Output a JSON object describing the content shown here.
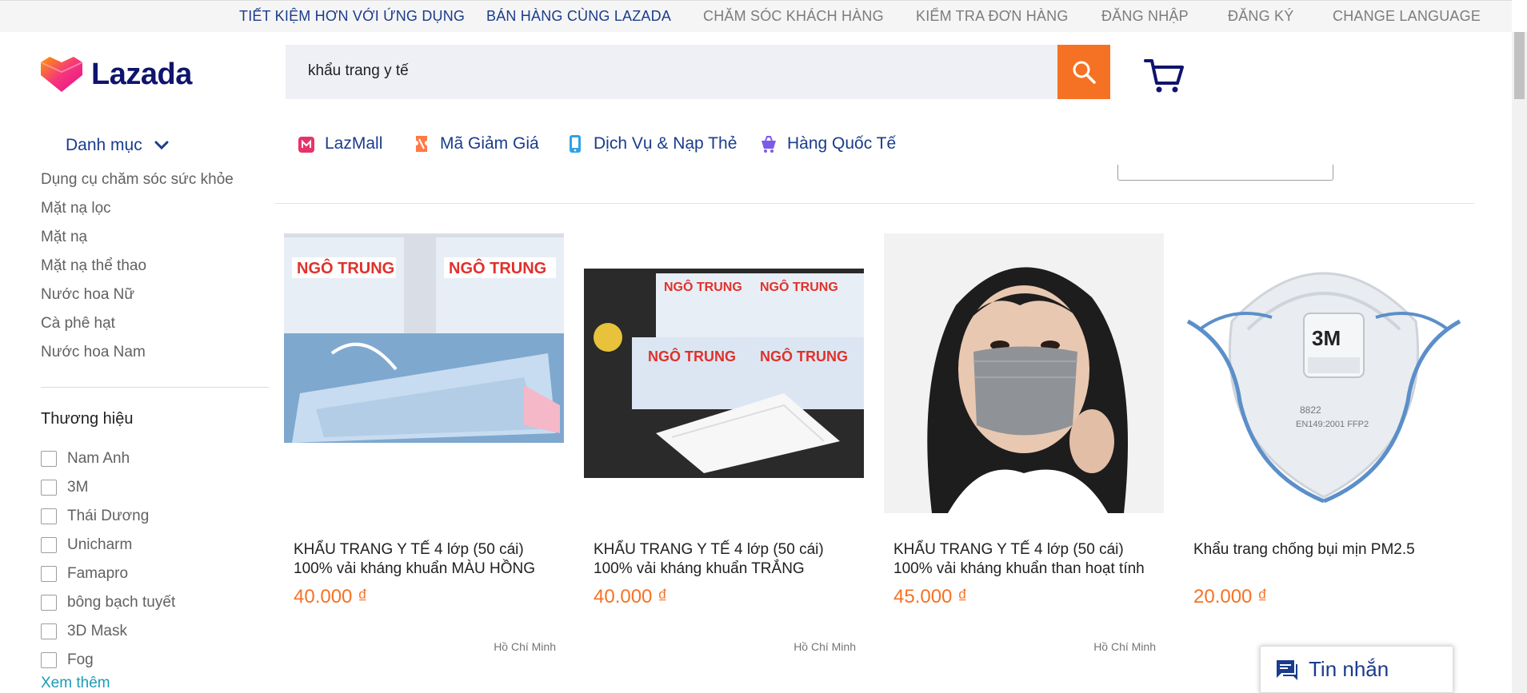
{
  "topbar": {
    "links": [
      "TIẾT KIỆM HƠN VỚI ỨNG DỤNG",
      "BÁN HÀNG CÙNG LAZADA",
      "CHĂM SÓC KHÁCH HÀNG",
      "KIỂM TRA ĐƠN HÀNG",
      "ĐĂNG NHẬP",
      "ĐĂNG KÝ",
      "CHANGE LANGUAGE"
    ]
  },
  "header": {
    "logo_text": "Lazada",
    "search_value": "khẩu trang y tế",
    "search_icon": "search-icon",
    "cart_icon": "cart-icon",
    "accent": "#f57224",
    "brand_color": "#0f146d"
  },
  "sidebar": {
    "category_label": "Danh mục",
    "categories": [
      "Dụng cụ chăm sóc sức khỏe",
      "Mặt nạ lọc",
      "Mặt nạ",
      "Mặt nạ thể thao",
      "Nước hoa Nữ",
      "Cà phê hạt",
      "Nước hoa Nam"
    ],
    "brand_title": "Thương hiệu",
    "brands": [
      "Nam Anh",
      "3M",
      "Thái Dương",
      "Unicharm",
      "Famapro",
      "bông bạch tuyết",
      "3D Mask",
      "Fog"
    ],
    "see_more": "Xem thêm"
  },
  "nav": {
    "items": [
      {
        "label": "LazMall",
        "icon": "lazmall-icon",
        "color": "#e8336a"
      },
      {
        "label": "Mã Giảm Giá",
        "icon": "voucher-icon",
        "color": "#ff7a45"
      },
      {
        "label": "Dịch Vụ & Nạp Thẻ",
        "icon": "topup-icon",
        "color": "#2ea2e9"
      },
      {
        "label": "Hàng Quốc Tế",
        "icon": "global-icon",
        "color": "#7b5ce8"
      }
    ]
  },
  "products": [
    {
      "title": "KHẨU TRANG Y TẾ 4 lớp (50 cái) 100% vải kháng khuẩn MÀU HỒNG",
      "price": "40.000 ₫",
      "location": "Hồ Chí Minh"
    },
    {
      "title": "KHẨU TRANG Y TẾ 4 lớp (50 cái) 100% vải kháng khuẩn TRẮNG",
      "price": "40.000 ₫",
      "location": "Hồ Chí Minh"
    },
    {
      "title": "KHẨU TRANG Y TẾ 4 lớp (50 cái) 100% vải kháng khuẩn than hoạt tính",
      "price": "45.000 ₫",
      "location": "Hồ Chí Minh"
    },
    {
      "title": "Khẩu trang chống bụi mịn PM2.5",
      "price": "20.000 ₫",
      "location": ""
    }
  ],
  "chat": {
    "label": "Tin nhắn",
    "icon": "chat-icon"
  }
}
